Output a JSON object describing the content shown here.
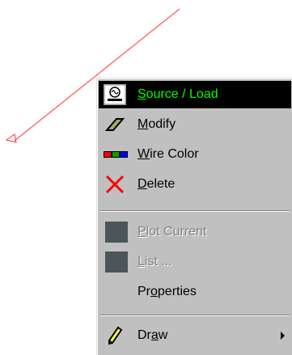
{
  "context_menu": {
    "items": [
      {
        "label": "Source / Load",
        "underline": "S",
        "rest": "ource / Load",
        "icon": "source-load-icon",
        "state": "selected"
      },
      {
        "label": "Modify",
        "underline": "M",
        "rest": "odify",
        "icon": "eraser-icon",
        "state": "normal"
      },
      {
        "label": "Wire Color",
        "underline": "W",
        "rest": "ire Color",
        "icon": "color-bars-icon",
        "state": "normal"
      },
      {
        "label": "Delete",
        "underline": "D",
        "rest": "elete",
        "icon": "red-x-icon",
        "state": "normal"
      },
      {
        "label": "Plot Current",
        "underline": "P",
        "rest": "lot Current",
        "icon": "disabled-box-icon",
        "state": "disabled"
      },
      {
        "label": "List ...",
        "underline": "L",
        "rest": "ist ...",
        "icon": "disabled-box-icon",
        "state": "disabled"
      },
      {
        "label": "Properties",
        "prefix": "Pr",
        "underline": "o",
        "rest": "perties",
        "icon": "",
        "state": "normal"
      },
      {
        "label": "Draw",
        "prefix": "Dr",
        "underline": "a",
        "rest": "w",
        "icon": "pencil-icon",
        "state": "normal",
        "submenu": true
      }
    ]
  },
  "colors": {
    "wire": "#ff3030",
    "menu_bg": "#c0c0c0",
    "selected_bg": "#000000",
    "selected_text": "#00ff00",
    "disabled_text": "#808080"
  }
}
